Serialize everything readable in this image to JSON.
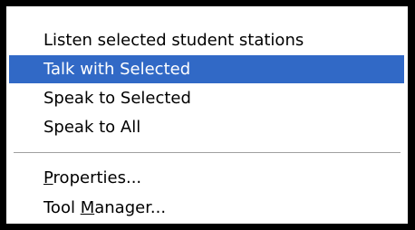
{
  "menu": {
    "items": [
      {
        "label": "Listen selected student stations",
        "selected": false
      },
      {
        "label": "Talk with Selected",
        "selected": true
      },
      {
        "label": "Speak to Selected",
        "selected": false
      },
      {
        "label": "Speak to All",
        "selected": false
      }
    ],
    "secondary_items": [
      {
        "label_before": "",
        "accel": "P",
        "label_after": "roperties..."
      },
      {
        "label_before": "Tool ",
        "accel": "M",
        "label_after": "anager..."
      }
    ]
  },
  "colors": {
    "selection_background": "#3169c6",
    "selection_text": "#ffffff",
    "frame": "#000000"
  }
}
